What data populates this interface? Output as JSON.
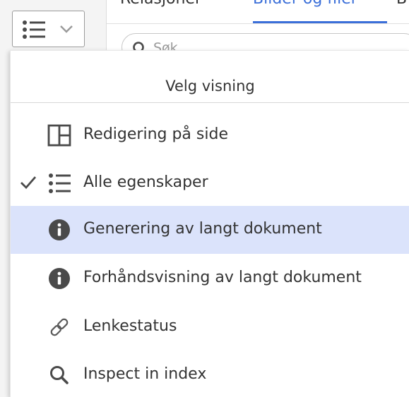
{
  "background": {
    "tabs": [
      {
        "label": "Relasjoner",
        "active": false
      },
      {
        "label": "Bilder og filer",
        "active": true
      },
      {
        "label": "B",
        "active": false
      }
    ],
    "search": {
      "placeholder": "Søk"
    },
    "view_toggle_icon": "list-view-icon"
  },
  "dropdown": {
    "title": "Velg visning",
    "items": [
      {
        "label": "Redigering på side",
        "icon": "layout-columns-icon",
        "checked": false,
        "highlighted": false
      },
      {
        "label": "Alle egenskaper",
        "icon": "list-view-icon",
        "checked": true,
        "highlighted": false
      },
      {
        "label": "Generering av langt dokument",
        "icon": "info-circle-icon",
        "checked": false,
        "highlighted": true
      },
      {
        "label": "Forhåndsvisning av langt dokument",
        "icon": "info-circle-icon",
        "checked": false,
        "highlighted": false
      },
      {
        "label": "Lenkestatus",
        "icon": "link-icon",
        "checked": false,
        "highlighted": false
      },
      {
        "label": "Inspect in index",
        "icon": "search-icon",
        "checked": false,
        "highlighted": false
      }
    ]
  },
  "colors": {
    "accent": "#3b6fd9",
    "highlight": "#dbe3fb",
    "text": "#333333",
    "icon": "#4a4a4a"
  }
}
